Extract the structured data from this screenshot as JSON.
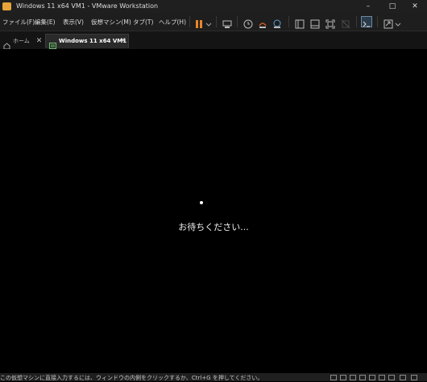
{
  "window": {
    "title": "Windows 11 x64 VM1 - VMware Workstation",
    "minimize": "–",
    "maximize": "□",
    "close": "✕"
  },
  "menu": {
    "items": [
      "ファイル(F)",
      "編集(E)",
      "表示(V)",
      "仮想マシン(M)",
      "タブ(T)",
      "ヘルプ(H)"
    ]
  },
  "toolbar": {
    "icons": [
      "pause-icon",
      "dropdown-icon",
      "send-ctrl-alt-del-icon",
      "snapshot-icon",
      "revert-snapshot-icon",
      "snapshot-manager-icon",
      "library-icon",
      "thumbnail-icon",
      "fullscreen-icon",
      "unity-icon",
      "console-icon",
      "view-mode-icon"
    ],
    "pause_color": "#e8872b"
  },
  "tabs": [
    {
      "label": "ホーム",
      "icon": "home-icon",
      "active": false
    },
    {
      "label": "Windows 11 x64 VM1",
      "icon": "vm-icon",
      "active": true
    }
  ],
  "vm": {
    "message": "お待ちください..."
  },
  "status": {
    "text": "この仮想マシンに直接入力するには、ウィンドウの内側をクリックするか、Ctrl+G を押してください。"
  }
}
